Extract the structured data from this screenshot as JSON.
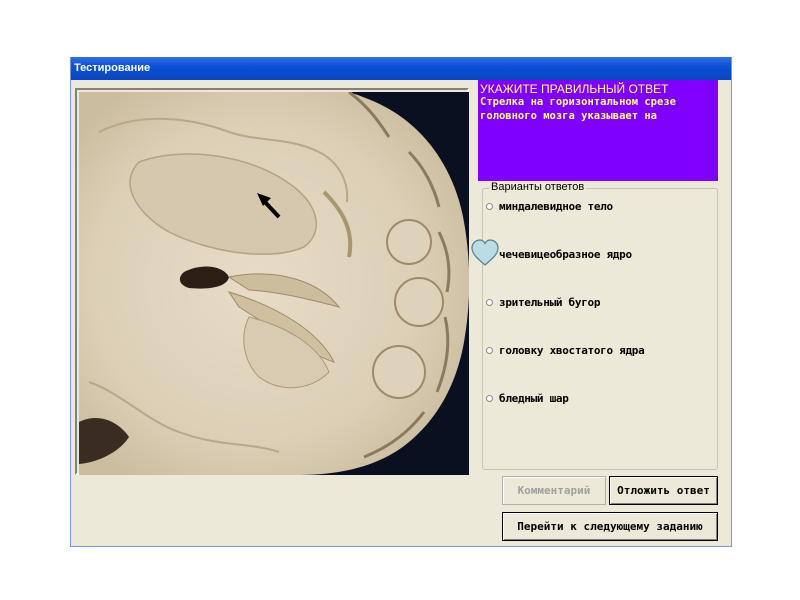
{
  "window": {
    "title": "Тестирование"
  },
  "image": {
    "alt": "brain-horizontal-section"
  },
  "question": {
    "header": "УКАЖИТЕ ПРАВИЛЬНЫЙ ОТВЕТ",
    "line1": "Стрелка на горизонтальном срезе",
    "line2": "головного мозга указывает на",
    "panel_color": "#8000ff",
    "text_color": "#ffff80"
  },
  "answers": {
    "legend": "Варианты ответов",
    "options": [
      {
        "label": "миндалевидное тело"
      },
      {
        "label": "чечевицеобразное ядро",
        "cursor": "heart"
      },
      {
        "label": "зрительный бугор"
      },
      {
        "label": "головку хвостатого ядра"
      },
      {
        "label": "бледный шар"
      }
    ]
  },
  "buttons": {
    "comment": "Комментарий",
    "postpone": "Отложить ответ",
    "next": "Перейти к следующему заданию"
  }
}
